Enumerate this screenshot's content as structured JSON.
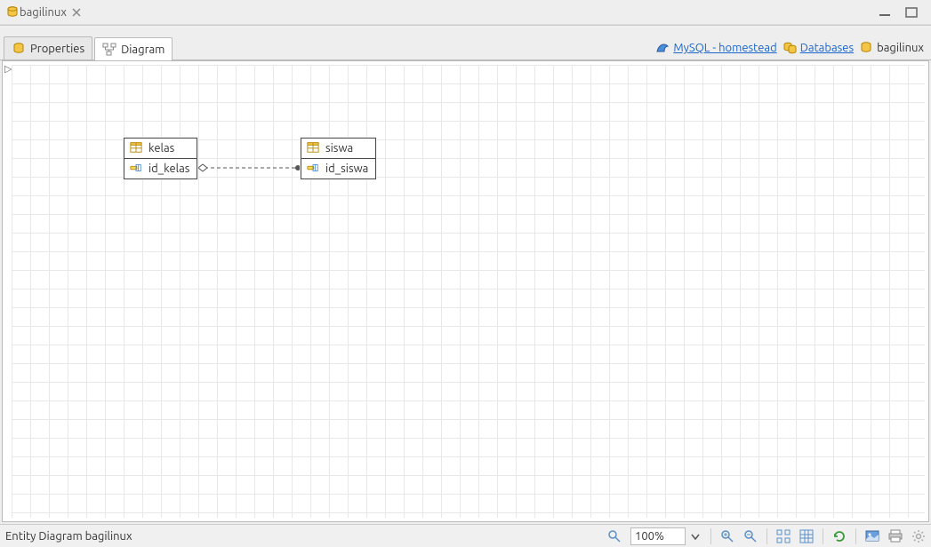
{
  "title": "bagilinux",
  "tabs": {
    "properties": {
      "label": "Properties"
    },
    "diagram": {
      "label": "Diagram"
    }
  },
  "breadcrumbs": {
    "connection": "MySQL - homestead",
    "databases": "Databases",
    "database": "bagilinux"
  },
  "entities": {
    "kelas": {
      "name": "kelas",
      "pk": "id_kelas"
    },
    "siswa": {
      "name": "siswa",
      "pk": "id_siswa"
    }
  },
  "status": {
    "text": "Entity Diagram bagilinux",
    "zoom": "100%"
  }
}
